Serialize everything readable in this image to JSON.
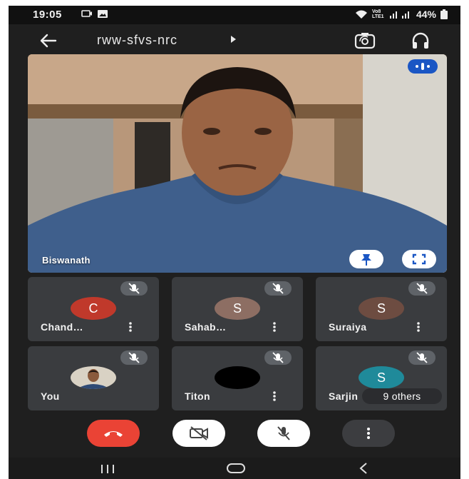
{
  "status": {
    "time": "19:05",
    "network": "Vo8 LTE1",
    "battery": "44%"
  },
  "meeting": {
    "code": "rww-sfvs-nrc"
  },
  "main_speaker": {
    "name": "Biswanath"
  },
  "participants": [
    {
      "name": "Chand…",
      "initial": "C",
      "color": "#c0392b"
    },
    {
      "name": "Sahab…",
      "initial": "S",
      "color": "#8d6e63"
    },
    {
      "name": "Suraiya",
      "initial": "S",
      "color": "#6d4c41"
    },
    {
      "name": "You",
      "initial": "",
      "color": "#2d2d2d"
    },
    {
      "name": "Titon",
      "initial": "",
      "color": "#000000"
    },
    {
      "name": "Sarjin",
      "initial": "S",
      "color": "#1f8a9a"
    }
  ],
  "others_label": "9 others",
  "icons": [
    "back-arrow-icon",
    "switch-camera-icon",
    "headphones-icon",
    "speaking-indicator-icon",
    "pin-icon",
    "fullscreen-icon",
    "mic-off-icon",
    "more-vert-icon",
    "end-call-icon",
    "camera-off-icon",
    "recent-apps-icon",
    "home-icon",
    "back-nav-icon"
  ],
  "colors": {
    "end_call": "#ea4335",
    "tile_bg": "#3a3c3f",
    "background": "#1f1f1f",
    "speaking": "#1a56c4"
  }
}
